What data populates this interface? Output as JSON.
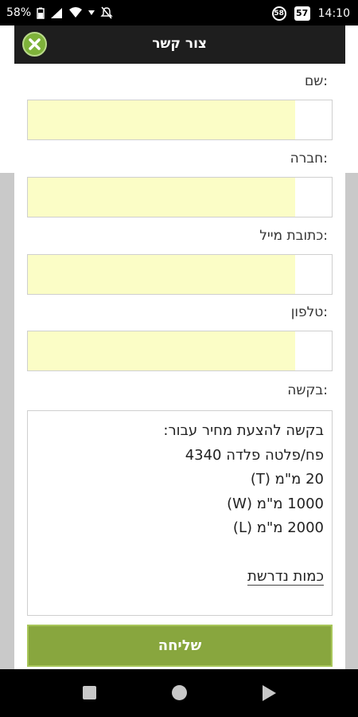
{
  "status_bar": {
    "battery_percent": "58%",
    "badge_circle": "58",
    "badge_square": "57",
    "time": "14:10",
    "icons": [
      "battery-icon",
      "signal-icon",
      "wifi-icon",
      "dropdown-arrow-icon",
      "mute-icon"
    ]
  },
  "dialog": {
    "title": "צור קשר",
    "close_icon": "close-icon",
    "accent_color": "#88a63e",
    "field_fill_color": "#fbfdc6"
  },
  "form": {
    "name_label": "שם:",
    "company_label": "חברה:",
    "email_label": "כתובת מייל:",
    "phone_label": "טלפון:",
    "request_label": "בקשה:",
    "name_value": "",
    "company_value": "",
    "email_value": "",
    "phone_value": "",
    "request_lines": [
      "בקשה להצעת מחיר עבור:",
      "פח/פלטה פלדה 4340",
      "20 מ\"מ (T)",
      "1000 מ\"מ (W)",
      "2000 מ\"מ (L)",
      "",
      "כמות נדרשת"
    ]
  },
  "submit_label": "שליחה",
  "nav": {
    "back_icon": "back-icon",
    "home_icon": "home-icon",
    "recent_icon": "recent-apps-icon"
  }
}
